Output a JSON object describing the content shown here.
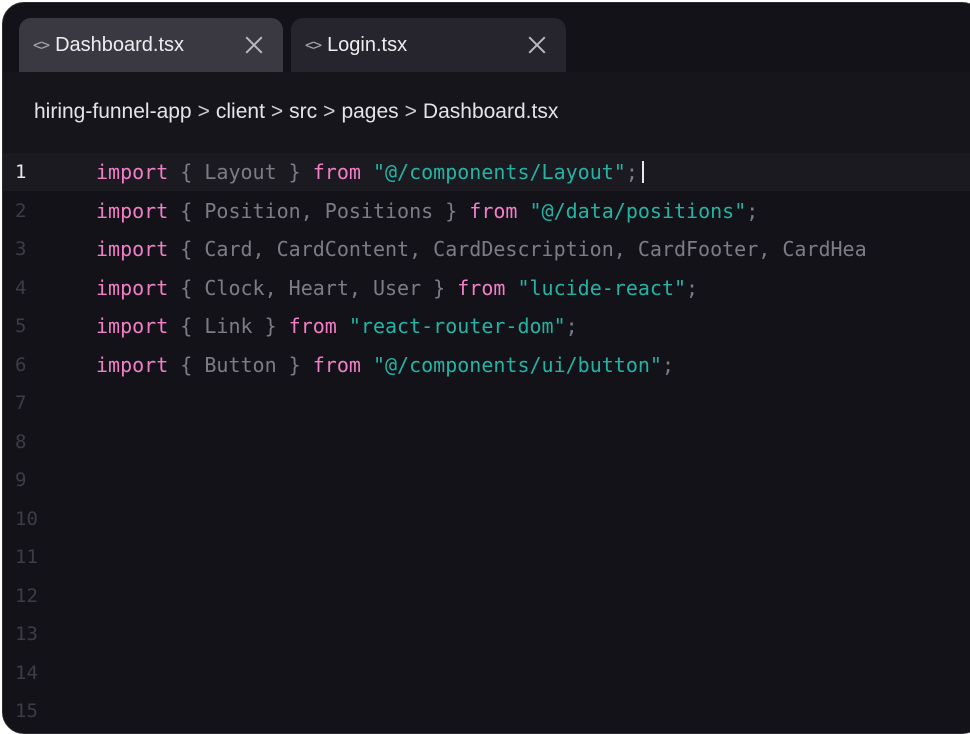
{
  "tabs": [
    {
      "icon": "code-icon",
      "label": "Dashboard.tsx",
      "active": true
    },
    {
      "icon": "code-icon",
      "label": "Login.tsx",
      "active": false
    }
  ],
  "breadcrumb": [
    "hiring-funnel-app",
    "client",
    "src",
    "pages",
    "Dashboard.tsx"
  ],
  "breadcrumb_separator": ">",
  "tab_icon_glyph": "<>",
  "editor": {
    "current_line": 1,
    "lines": [
      {
        "n": "1",
        "tokens": [
          {
            "t": "kw",
            "v": "import"
          },
          {
            "t": "pl",
            "v": " { Layout } "
          },
          {
            "t": "kw",
            "v": "from"
          },
          {
            "t": "pl",
            "v": " "
          },
          {
            "t": "str",
            "v": "\"@/components/Layout\""
          },
          {
            "t": "pl",
            "v": ";"
          }
        ]
      },
      {
        "n": "2",
        "tokens": [
          {
            "t": "kw",
            "v": "import"
          },
          {
            "t": "pl",
            "v": " { Position, Positions } "
          },
          {
            "t": "kw",
            "v": "from"
          },
          {
            "t": "pl",
            "v": " "
          },
          {
            "t": "str",
            "v": "\"@/data/positions\""
          },
          {
            "t": "pl",
            "v": ";"
          }
        ]
      },
      {
        "n": "3",
        "tokens": [
          {
            "t": "kw",
            "v": "import"
          },
          {
            "t": "pl",
            "v": " { Card, CardContent, CardDescription, CardFooter, CardHea"
          }
        ]
      },
      {
        "n": "4",
        "tokens": [
          {
            "t": "kw",
            "v": "import"
          },
          {
            "t": "pl",
            "v": " { Clock, Heart, User } "
          },
          {
            "t": "kw",
            "v": "from"
          },
          {
            "t": "pl",
            "v": " "
          },
          {
            "t": "str",
            "v": "\"lucide-react\""
          },
          {
            "t": "pl",
            "v": ";"
          }
        ]
      },
      {
        "n": "5",
        "tokens": [
          {
            "t": "kw",
            "v": "import"
          },
          {
            "t": "pl",
            "v": " { Link } "
          },
          {
            "t": "kw",
            "v": "from"
          },
          {
            "t": "pl",
            "v": " "
          },
          {
            "t": "str",
            "v": "\"react-router-dom\""
          },
          {
            "t": "pl",
            "v": ";"
          }
        ]
      },
      {
        "n": "6",
        "tokens": [
          {
            "t": "kw",
            "v": "import"
          },
          {
            "t": "pl",
            "v": " { Button } "
          },
          {
            "t": "kw",
            "v": "from"
          },
          {
            "t": "pl",
            "v": " "
          },
          {
            "t": "str",
            "v": "\"@/components/ui/button\""
          },
          {
            "t": "pl",
            "v": ";"
          }
        ]
      },
      {
        "n": "7",
        "tokens": []
      },
      {
        "n": "8",
        "tokens": []
      },
      {
        "n": "9",
        "tokens": []
      },
      {
        "n": "10",
        "tokens": []
      },
      {
        "n": "11",
        "tokens": []
      },
      {
        "n": "12",
        "tokens": []
      },
      {
        "n": "13",
        "tokens": []
      },
      {
        "n": "14",
        "tokens": []
      },
      {
        "n": "15",
        "tokens": []
      }
    ]
  },
  "colors": {
    "background": "#131219",
    "keyword": "#f07fc6",
    "string": "#24b3a3",
    "plain": "#7d7c86",
    "line_number": "#3d3c45",
    "active_tab": "#3a3942",
    "inactive_tab": "#26252d"
  }
}
